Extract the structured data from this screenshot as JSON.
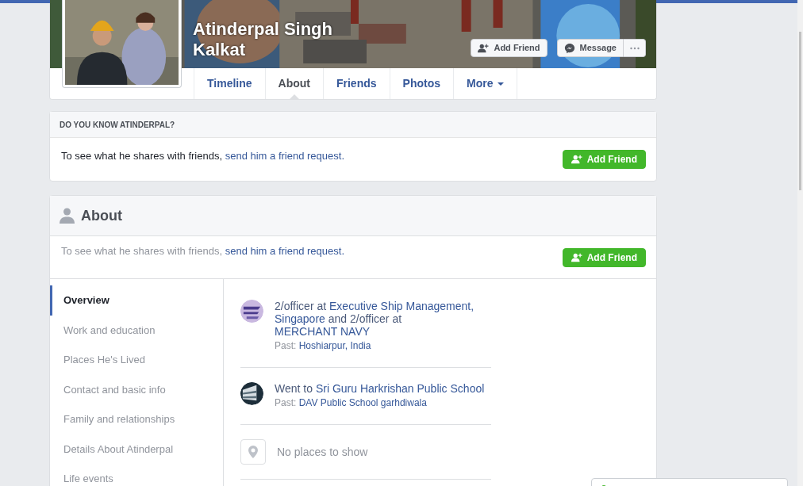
{
  "profile": {
    "name": "Atinderpal Singh Kalkat",
    "actions": [
      {
        "kind": "add_friend",
        "label": "Add Friend"
      },
      {
        "kind": "message",
        "label": "Message"
      },
      {
        "kind": "more"
      }
    ],
    "tabs": [
      {
        "label": "Timeline",
        "selected": false,
        "dropdown": false
      },
      {
        "label": "About",
        "selected": true,
        "dropdown": false
      },
      {
        "label": "Friends",
        "selected": false,
        "dropdown": false
      },
      {
        "label": "Photos",
        "selected": false,
        "dropdown": false
      },
      {
        "label": "More",
        "selected": false,
        "dropdown": true
      }
    ]
  },
  "know_card": {
    "title": "DO YOU KNOW ATINDERPAL?",
    "message": {
      "text": "To see what he shares with friends,",
      "link": "send him a friend request."
    },
    "button": "Add Friend"
  },
  "about": {
    "title": "About",
    "message": {
      "text": "To see what he shares with friends,",
      "link": "send him a friend request."
    },
    "button": "Add Friend",
    "nav": [
      {
        "label": "Overview",
        "selected": true
      },
      {
        "label": "Work and education",
        "selected": false
      },
      {
        "label": "Places He's Lived",
        "selected": false
      },
      {
        "label": "Contact and basic info",
        "selected": false
      },
      {
        "label": "Family and relationships",
        "selected": false
      },
      {
        "label": "Details About Atinderpal",
        "selected": false
      },
      {
        "label": "Life events",
        "selected": false
      }
    ],
    "items": [
      {
        "kind": "picture",
        "title": [
          {
            "text": "2/officer at"
          },
          {
            "link": "Executive Ship Management,"
          },
          {
            "link": "Singapore"
          },
          {
            "text": "and 2/officer at"
          },
          {
            "link": "MERCHANT NAVY"
          }
        ],
        "past_label": "Past:",
        "past": "Hoshiarpur, India"
      },
      {
        "kind": "picture",
        "title": [
          {
            "text": "Went to"
          },
          {
            "link": "Sri Guru Harkrishan Public School"
          }
        ],
        "past_label": "Past:",
        "past": "DAV Public School garhdiwala"
      },
      {
        "kind": "empty",
        "message": "No places to show"
      }
    ]
  }
}
